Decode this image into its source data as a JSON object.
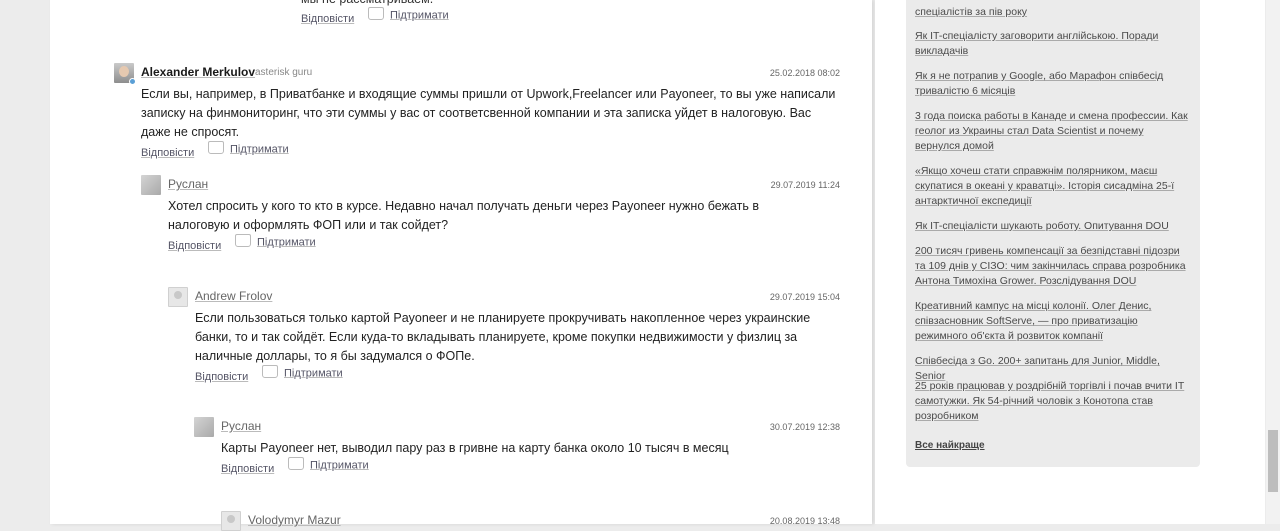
{
  "comments": [
    {
      "author": "",
      "company": "",
      "date": "",
      "text": "мы не рассматриваем.",
      "reply": "Відповісти",
      "support": "Підтримати"
    },
    {
      "author": "Alexander Merkulov",
      "company": "asterisk guru",
      "date": "25.02.2018 08:02",
      "text": "Если вы, например, в Приватбанке и входящие суммы пришли от Upwork,Freelancer или Payoneer, то вы уже написали записку на финмониторинг, что эти суммы у вас от соответсвенной компании и эта записка уйдет в налоговую. Вас даже не спросят.",
      "reply": "Відповісти",
      "support": "Підтримати"
    },
    {
      "author": "Руслан",
      "company": "",
      "date": "29.07.2019 11:24",
      "text": "Хотел спросить у кого то кто в курсе. Недавно начал получать деньги через Payoneer нужно бежать в налоговую и оформлять ФОП или и так сойдет?",
      "reply": "Відповісти",
      "support": "Підтримати"
    },
    {
      "author": "Andrew Frolov",
      "company": "",
      "date": "29.07.2019 15:04",
      "text": "Если пользоваться только картой Payoneer и не планируете прокручивать накопленное через украинские банки, то и так сойдёт. Если куда-то вкладывать планируете, кроме покупки недвижимости у физлиц за наличные доллары, то я бы задумался о ФОПе.",
      "reply": "Відповісти",
      "support": "Підтримати"
    },
    {
      "author": "Руслан",
      "company": "",
      "date": "30.07.2019 12:38",
      "text": "Карты Payoneer нет, выводил пару раз в гривне на карту банка около 10 тысяч в месяц",
      "reply": "Відповісти",
      "support": "Підтримати"
    },
    {
      "author": "Volodymyr Mazur",
      "company": "",
      "date": "20.08.2019 13:48",
      "text": "",
      "reply": "",
      "support": ""
    }
  ],
  "sidebar": {
    "items": [
      "Як IT-спеціалісту заговорити англійською. Поради викладачів",
      "Як я не потрапив у Google, або Марафон співбесід тривалістю 6 місяців",
      "3 года поиска работы в Канаде и смена профессии. Как геолог из Украины стал Data Scientist и почему вернулся домой",
      "«Якщо хочеш стати справжнім полярником, маєш скупатися в океані у краватці». Історія сисадміна 25-ї антарктичної експедиції",
      "Як IT-спеціалісти шукають роботу. Опитування DOU",
      "200 тисяч гривень компенсації за безпідставні підозри та 109 днів у СІЗО: чим закінчилась справа розробника Антона Тимохіна Grower. Розслідування DOU",
      "Креативний кампус на місці колонії. Олег Денис, співзасновник SoftServe, — про приватизацію режимного об'єкта й розвиток компанії",
      "Співбесіда з Go. 200+ запитань для Junior, Middle, Senior",
      "25 років працював у роздрібній торгівлі і почав вчити IT самотужки. Як 54-річний чоловік з Конотопа став розробником"
    ],
    "top_item": "спеціалістів за пів року",
    "all_best": "Все найкраще"
  }
}
